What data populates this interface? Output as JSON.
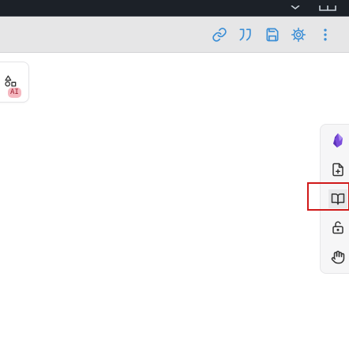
{
  "toolbar": {
    "icons": [
      "link-icon",
      "quote-icon",
      "save-icon",
      "settings-cog-icon",
      "more-vertical-icon"
    ],
    "accent_color": "#3b8ed6"
  },
  "left_tool": {
    "icon": "shapes-icon",
    "badge": "AI",
    "badge_color": "#f5b8c0"
  },
  "right_panel": {
    "items": [
      {
        "icon": "obsidian-logo-icon"
      },
      {
        "icon": "file-plus-icon"
      },
      {
        "icon": "book-open-icon",
        "active": true
      },
      {
        "icon": "unlock-icon"
      },
      {
        "icon": "hand-icon"
      }
    ]
  }
}
